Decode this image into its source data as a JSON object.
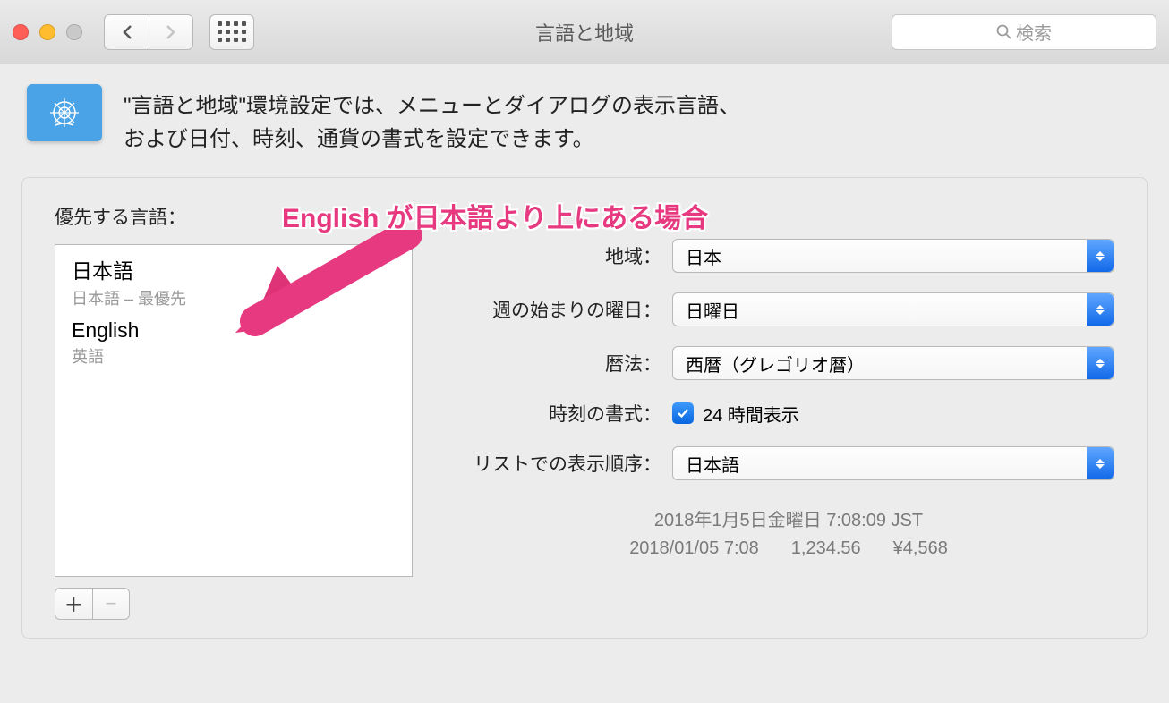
{
  "titlebar": {
    "title": "言語と地域",
    "search_placeholder": "検索"
  },
  "header": {
    "line1": "\"言語と地域\"環境設定では、メニューとダイアログの表示言語、",
    "line2": "および日付、時刻、通貨の書式を設定できます。"
  },
  "annotation": "English が日本語より上にある場合",
  "left": {
    "section_label": "優先する言語：",
    "languages": [
      {
        "primary": "日本語",
        "sub": "日本語 – 最優先"
      },
      {
        "primary": "English",
        "sub": "英語"
      }
    ]
  },
  "right": {
    "region_label": "地域：",
    "region_value": "日本",
    "week_label": "週の始まりの曜日：",
    "week_value": "日曜日",
    "calendar_label": "暦法：",
    "calendar_value": "西暦（グレゴリオ暦）",
    "time_label": "時刻の書式：",
    "time_checkbox_label": "24 時間表示",
    "sort_label": "リストでの表示順序：",
    "sort_value": "日本語",
    "example_line1": "2018年1月5日金曜日 7:08:09 JST",
    "example_date": "2018/01/05 7:08",
    "example_number": "1,234.56",
    "example_currency": "¥4,568"
  }
}
